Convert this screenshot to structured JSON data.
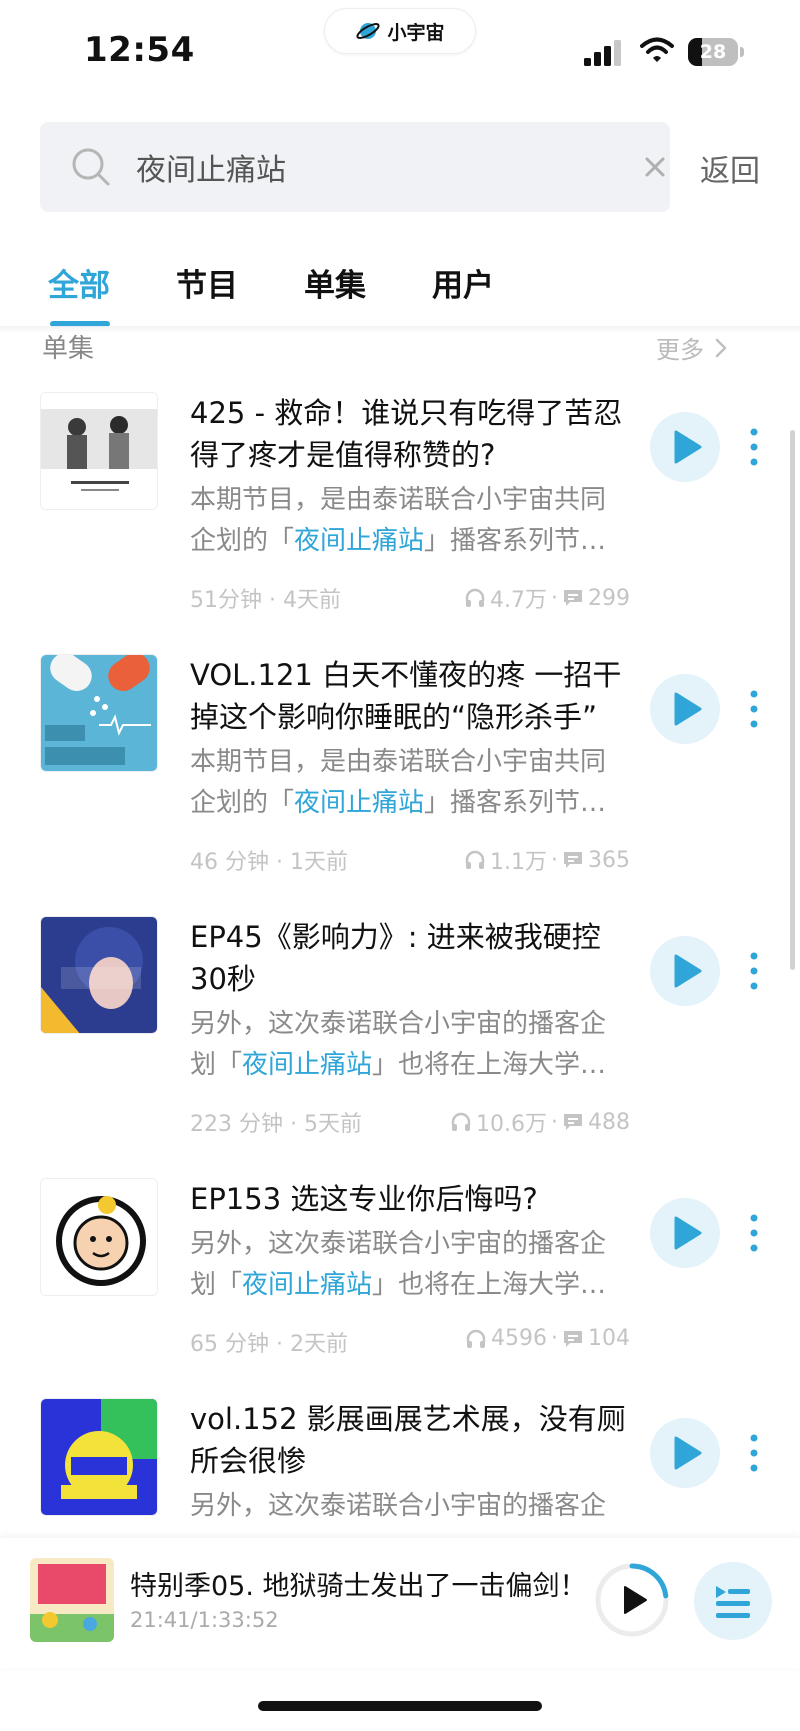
{
  "status_bar": {
    "time": "12:54",
    "app_name": "小宇宙",
    "battery": "28",
    "battery_level": 0.28
  },
  "search": {
    "value": "夜间止痛站",
    "back_label": "返回"
  },
  "tabs": [
    {
      "label": "全部",
      "active": true
    },
    {
      "label": "节目",
      "active": false
    },
    {
      "label": "单集",
      "active": false
    },
    {
      "label": "用户",
      "active": false
    }
  ],
  "section": {
    "title": "单集",
    "more_label": "更多"
  },
  "episodes": [
    {
      "title": "425 - 救命！谁说只有吃得了苦忍得了疼才是值得称赞的?",
      "desc_pre": "本期节目，是由泰诺联合小宇宙共同企划的「",
      "desc_hl": "夜间止痛站",
      "desc_post": "」播客系列节目之一",
      "duration": "51分钟",
      "ago": "4天前",
      "plays": "4.7万",
      "comments": "299"
    },
    {
      "title": "VOL.121 白天不懂夜的疼 一招干掉这个影响你睡眠的“隐形杀手”",
      "desc_pre": "本期节目，是由泰诺联合小宇宙共同企划的「",
      "desc_hl": "夜间止痛站",
      "desc_post": "」播客系列节目之一",
      "duration": "46 分钟",
      "ago": "1天前",
      "plays": "1.1万",
      "comments": "365"
    },
    {
      "title": "EP45《影响力》: 进来被我硬控30秒",
      "desc_pre": "另外，这次泰诺联合小宇宙的播客企划「",
      "desc_hl": "夜间止痛站",
      "desc_post": "」也将在上海大学路举办",
      "duration": "223 分钟",
      "ago": "5天前",
      "plays": "10.6万",
      "comments": "488"
    },
    {
      "title": "EP153 选这专业你后悔吗?",
      "desc_pre": "另外，这次泰诺联合小宇宙的播客企划「",
      "desc_hl": "夜间止痛站",
      "desc_post": "」也将在上海大学路举办",
      "duration": "65 分钟",
      "ago": "2天前",
      "plays": "4596",
      "comments": "104"
    },
    {
      "title": "vol.152 影展画展艺术展，没有厕所会很惨",
      "desc_pre": "另外，这次泰诺联合小宇宙的播客企",
      "desc_hl": "",
      "desc_post": "",
      "duration": "",
      "ago": "",
      "plays": "",
      "comments": ""
    }
  ],
  "player": {
    "title": "特别季05. 地狱骑士发出了一击偏剑！",
    "progress": "21:41/1:33:52",
    "progress_fraction": 0.23
  },
  "colors": {
    "accent": "#2fa5d8",
    "accent_light": "#e4f3fa",
    "muted": "#8a8a8a"
  }
}
